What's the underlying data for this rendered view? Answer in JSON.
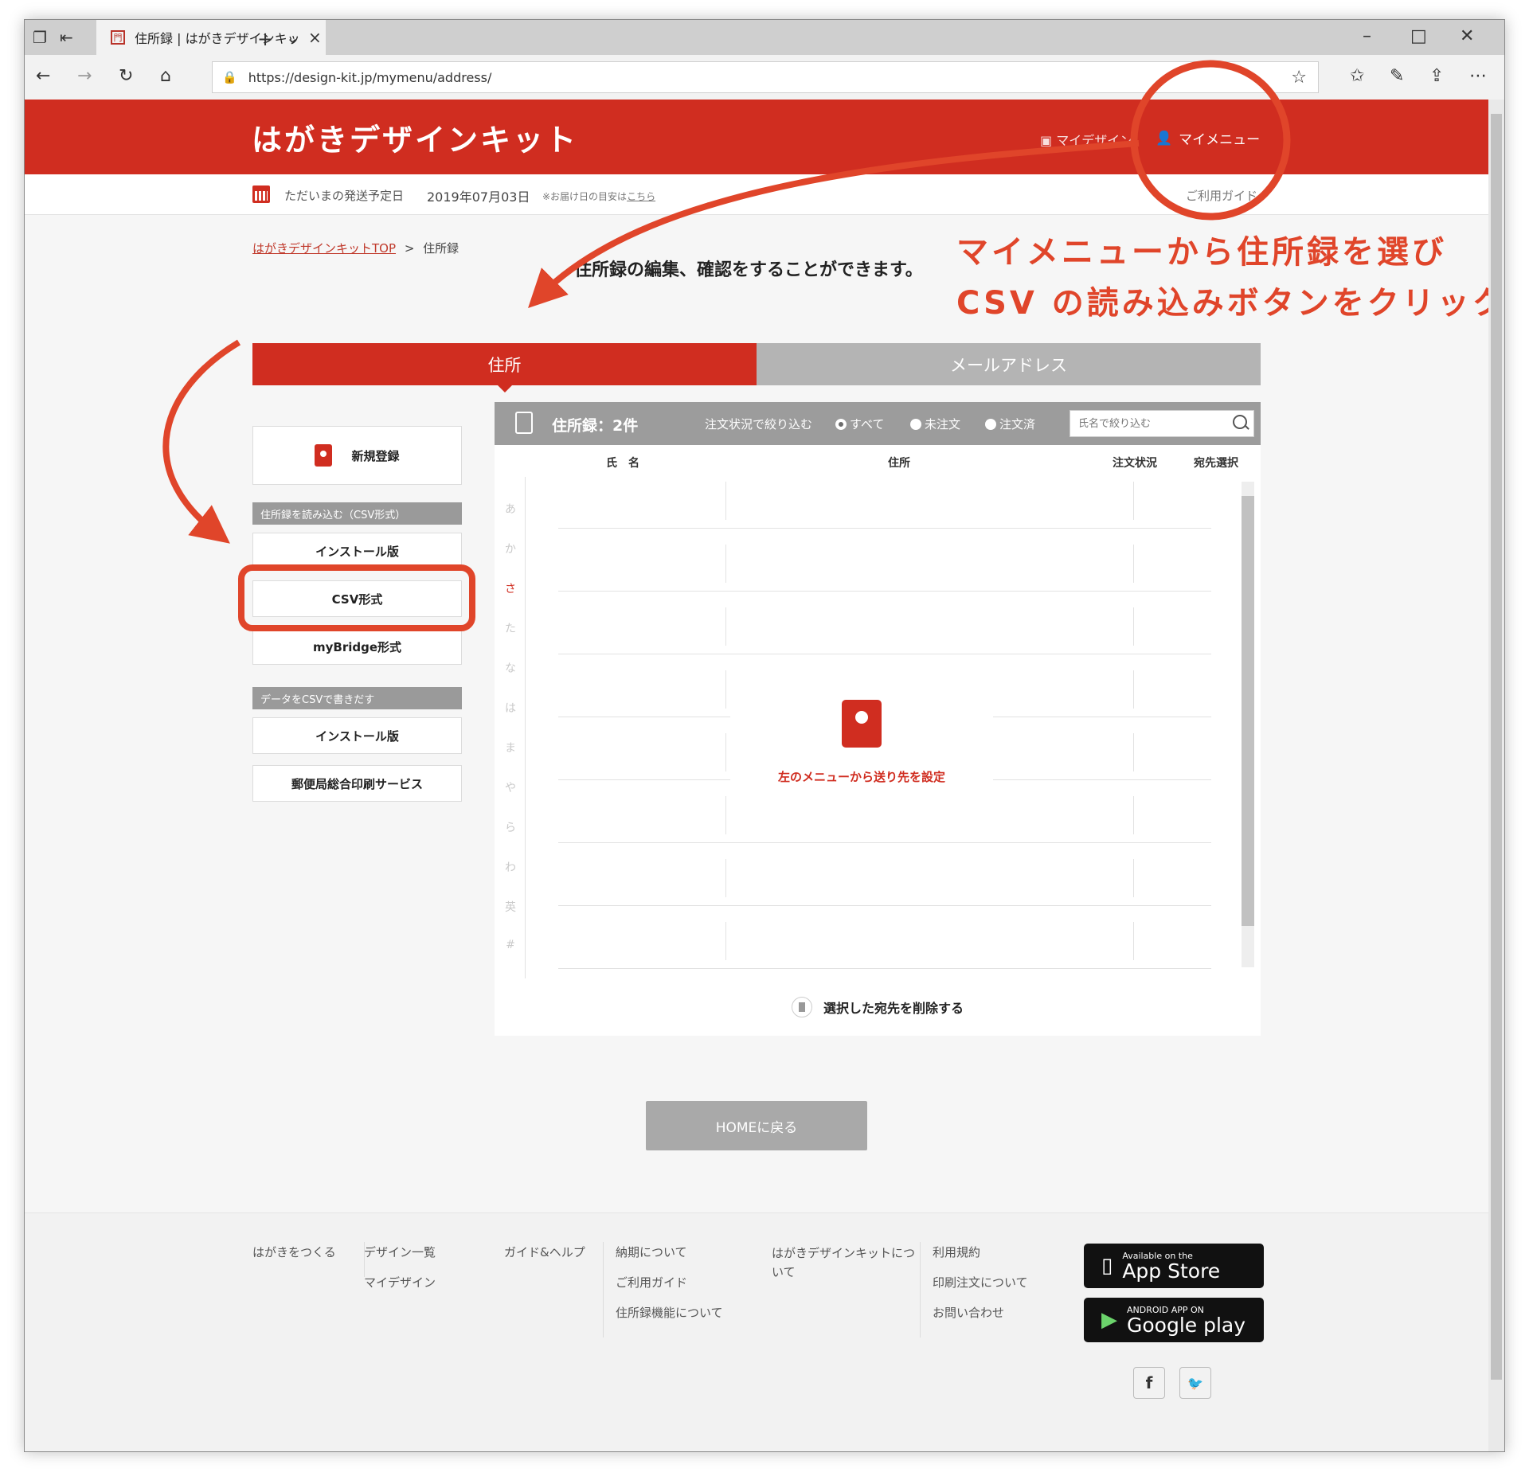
{
  "browser": {
    "tab_title": "住所録 | はがきデザインキット",
    "url": "https://design-kit.jp/mymenu/address/"
  },
  "header": {
    "logo": "はがきデザインキット",
    "nav_mydesign": "マイデザイン",
    "nav_mymenu": "マイメニュー"
  },
  "subbar": {
    "ship_label": "ただいまの発送予定日",
    "ship_date": "2019年07月03日",
    "ship_note": "※お届け日の目安は",
    "ship_note_link": "こちら",
    "guide": "ご利用ガイド"
  },
  "breadcrumb": {
    "home": "はがきデザインキットTOP",
    "sep": ">",
    "current": "住所録"
  },
  "lead": "住所録の編集、確認をすることができます。",
  "callout": {
    "line1": "マイメニューから住所録を選び",
    "line2": "CSV の読み込みボタンをクリック"
  },
  "tabs": {
    "address": "住所",
    "mail": "メールアドレス"
  },
  "sidebar": {
    "new_button": "新規登録",
    "import_heading": "住所録を読み込む（CSV形式）",
    "import_items": [
      "インストール版",
      "CSV形式",
      "myBridge形式"
    ],
    "export_heading": "データをCSVで書きだす",
    "export_items": [
      "インストール版",
      "郵便局総合印刷サービス"
    ]
  },
  "panel": {
    "count_label": "住所録：2件",
    "filter_label": "注文状況で絞り込む",
    "radios": [
      "すべて",
      "未注文",
      "注文済"
    ],
    "search_placeholder": "氏名で絞り込む",
    "columns": [
      "氏　名",
      "住所",
      "注文状況",
      "宛先選択"
    ],
    "kana_index": [
      "あ",
      "か",
      "さ",
      "た",
      "な",
      "は",
      "ま",
      "や",
      "ら",
      "わ",
      "英",
      "#"
    ],
    "empty_message": "左のメニューから送り先を設定",
    "delete_label": "選択した宛先を削除する"
  },
  "home_button": "HOMEに戻る",
  "footer": {
    "col1": [
      "はがきをつくる"
    ],
    "col2": [
      "デザイン一覧",
      "マイデザイン"
    ],
    "col3": [
      "ガイド&ヘルプ"
    ],
    "col4": [
      "納期について",
      "ご利用ガイド",
      "住所録機能について"
    ],
    "col5": [
      "はがきデザインキットについて"
    ],
    "col6": [
      "利用規約",
      "印刷注文について",
      "お問い合わせ"
    ],
    "appstore_small": "Available on the",
    "appstore_big": "App Store",
    "googleplay_small": "ANDROID APP ON",
    "googleplay_big": "Google play"
  },
  "colors": {
    "brand_red": "#d02d20",
    "annotation_red": "#e0452a"
  }
}
